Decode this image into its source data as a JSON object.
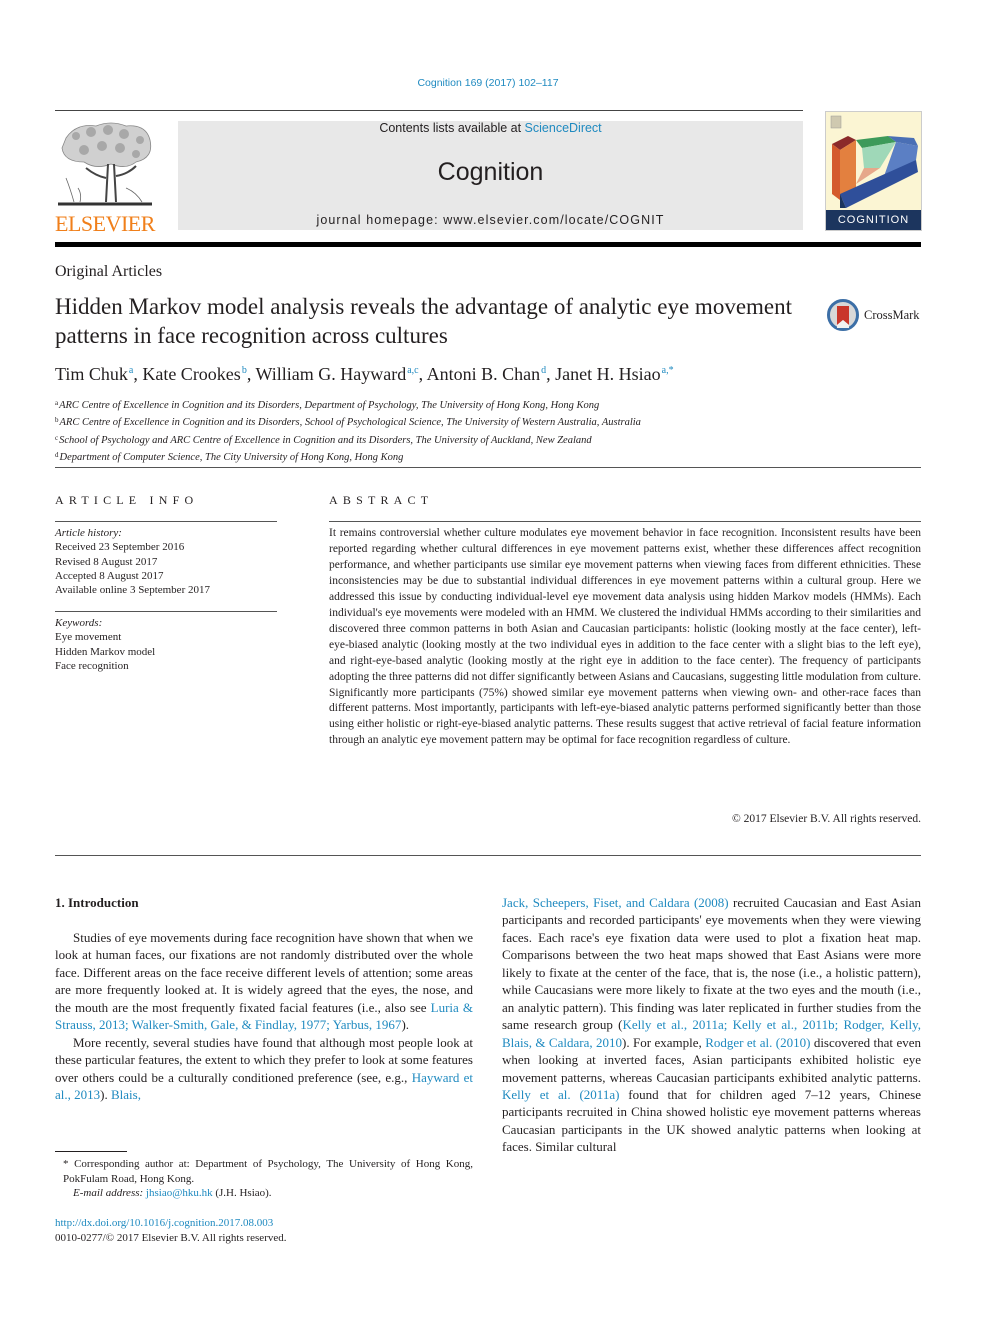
{
  "header": {
    "journal_ref": "Cognition 169 (2017) 102–117",
    "contents_prefix": "Contents lists available at ",
    "contents_link": "ScienceDirect",
    "journal_title": "Cognition",
    "homepage": "journal homepage: www.elsevier.com/locate/COGNIT",
    "publisher_logo": "ELSEVIER",
    "cover_label": "COGNITION"
  },
  "article": {
    "section": "Original Articles",
    "title": "Hidden Markov model analysis reveals the advantage of analytic eye movement patterns in face recognition across cultures",
    "crossmark": "CrossMark",
    "authors": [
      {
        "name": "Tim Chuk",
        "sup": "a",
        "sep": ", "
      },
      {
        "name": "Kate Crookes",
        "sup": "b",
        "sep": ", "
      },
      {
        "name": "William G. Hayward",
        "sup": "a,c",
        "sep": ", "
      },
      {
        "name": "Antoni B. Chan",
        "sup": "d",
        "sep": ", "
      },
      {
        "name": "Janet H. Hsiao",
        "sup": "a,*",
        "sep": ""
      }
    ],
    "affiliations": [
      {
        "key": "a",
        "text": "ARC Centre of Excellence in Cognition and its Disorders, Department of Psychology, The University of Hong Kong, Hong Kong"
      },
      {
        "key": "b",
        "text": "ARC Centre of Excellence in Cognition and its Disorders, School of Psychological Science, The University of Western Australia, Australia"
      },
      {
        "key": "c",
        "text": "School of Psychology and ARC Centre of Excellence in Cognition and its Disorders, The University of Auckland, New Zealand"
      },
      {
        "key": "d",
        "text": "Department of Computer Science, The City University of Hong Kong, Hong Kong"
      }
    ]
  },
  "article_info": {
    "heading": "ARTICLE INFO",
    "history_label": "Article history:",
    "history": [
      "Received 23 September 2016",
      "Revised 8 August 2017",
      "Accepted 8 August 2017",
      "Available online 3 September 2017"
    ],
    "keywords_label": "Keywords:",
    "keywords": [
      "Eye movement",
      "Hidden Markov model",
      "Face recognition"
    ]
  },
  "abstract": {
    "heading": "ABSTRACT",
    "text": "It remains controversial whether culture modulates eye movement behavior in face recognition. Inconsistent results have been reported regarding whether cultural differences in eye movement patterns exist, whether these differences affect recognition performance, and whether participants use similar eye movement patterns when viewing faces from different ethnicities. These inconsistencies may be due to substantial individual differences in eye movement patterns within a cultural group. Here we addressed this issue by conducting individual-level eye movement data analysis using hidden Markov models (HMMs). Each individual's eye movements were modeled with an HMM. We clustered the individual HMMs according to their similarities and discovered three common patterns in both Asian and Caucasian participants: holistic (looking mostly at the face center), left-eye-biased analytic (looking mostly at the two individual eyes in addition to the face center with a slight bias to the left eye), and right-eye-based analytic (looking mostly at the right eye in addition to the face center). The frequency of participants adopting the three patterns did not differ significantly between Asians and Caucasians, suggesting little modulation from culture. Significantly more participants (75%) showed similar eye movement patterns when viewing own- and other-race faces than different patterns. Most importantly, participants with left-eye-biased analytic patterns performed significantly better than those using either holistic or right-eye-biased analytic patterns. These results suggest that active retrieval of facial feature information through an analytic eye movement pattern may be optimal for face recognition regardless of culture.",
    "copyright": "© 2017 Elsevier B.V. All rights reserved."
  },
  "introduction": {
    "heading": "1. Introduction",
    "p1_text": "Studies of eye movements during face recognition have shown that when we look at human faces, our fixations are not randomly distributed over the whole face. Different areas on the face receive different levels of attention; some areas are more frequently looked at. It is widely agreed that the eyes, the nose, and the mouth are the most frequently fixated facial features (i.e., also see ",
    "p1_link": "Luria & Strauss, 2013; Walker-Smith, Gale, & Findlay, 1977; Yarbus, 1967",
    "p1_end": ").",
    "p2_text": "More recently, several studies have found that although most people look at these particular features, the extent to which they prefer to look at some features over others could be a culturally conditioned preference (see, e.g., ",
    "p2_link1": "Hayward et al., 2013",
    "p2_mid": "). ",
    "p2_link2": "Blais,",
    "r_link1": "Jack, Scheepers, Fiset, and Caldara (2008)",
    "r_text1": " recruited Caucasian and East Asian participants and recorded participants' eye movements when they were viewing faces. Each race's eye fixation data were used to plot a fixation heat map. Comparisons between the two heat maps showed that East Asians were more likely to fixate at the center of the face, that is, the nose (i.e., a holistic pattern), while Caucasians were more likely to fixate at the two eyes and the mouth (i.e., an analytic pattern). This finding was later replicated in further studies from the same research group (",
    "r_link2": "Kelly et al., 2011a; Kelly et al., 2011b; Rodger, Kelly, Blais, & Caldara, 2010",
    "r_text2": "). For example, ",
    "r_link3": "Rodger et al. (2010)",
    "r_text3": " discovered that even when looking at inverted faces, Asian participants exhibited holistic eye movement patterns, whereas Caucasian participants exhibited analytic patterns. ",
    "r_link4": "Kelly et al. (2011a)",
    "r_text4": " found that for children aged 7–12 years, Chinese participants recruited in China showed holistic eye movement patterns whereas Caucasian participants in the UK showed analytic patterns when looking at faces. Similar cultural"
  },
  "footnote": {
    "corresponding": "* Corresponding author at: Department of Psychology, The University of Hong Kong, PokFulam Road, Hong Kong.",
    "email_label": "E-mail address: ",
    "email": "jhsiao@hku.hk",
    "email_suffix": " (J.H. Hsiao).",
    "doi": "http://dx.doi.org/10.1016/j.cognition.2017.08.003",
    "issn": "0010-0277/© 2017 Elsevier B.V. All rights reserved."
  },
  "colors": {
    "link": "#1f8ac0",
    "elsevier_orange": "#f07f1a",
    "masthead_bg": "#e8e8e8",
    "cover_navy": "#1c355e"
  }
}
